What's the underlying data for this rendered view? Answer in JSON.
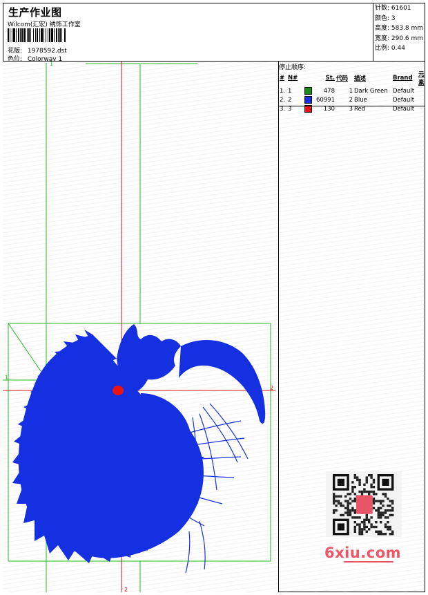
{
  "header": {
    "title": "生产作业图",
    "company": "Wilcom(汇宏) 绣饰工作室",
    "design_label": "花版:",
    "design_value": "1978592.dst",
    "colorway_label": "色位:",
    "colorway_value": "Colorway 1"
  },
  "stats": {
    "stitches": "针数: 61601",
    "colors": "颜色: 3",
    "height": "高度: 583.8 mm",
    "width": "宽度: 290.6 mm",
    "scale": "比例: 0.44"
  },
  "panel": {
    "title": "停止顺序:",
    "headers": [
      "#",
      "N#",
      "",
      "St.",
      "代码",
      "描述",
      "Brand",
      "元素"
    ],
    "rows": [
      {
        "num": "1.",
        "needle": "1",
        "color": "#1a8a1a",
        "stitches": "478",
        "code": "1",
        "desc": "Dark Green",
        "brand": "Default"
      },
      {
        "num": "2.",
        "needle": "2",
        "color": "#1530e0",
        "stitches": "60991",
        "code": "2",
        "desc": "Blue",
        "brand": "Default"
      },
      {
        "num": "3.",
        "needle": "3",
        "color": "#e81414",
        "stitches": "130",
        "code": "3",
        "desc": "Red",
        "brand": "Default"
      }
    ]
  },
  "canvas": {
    "marker_green_top": "1",
    "marker_green_left": "1",
    "marker_red_right": "2",
    "marker_red_bottom": "2"
  },
  "watermark": {
    "text": "6xiu.com"
  },
  "colors": {
    "guide_green": "#22bb22",
    "guide_red": "#dd1111",
    "embroidery_blue": "#1530e0",
    "embroidery_red": "#e81414",
    "watermark": "#ee5566"
  }
}
